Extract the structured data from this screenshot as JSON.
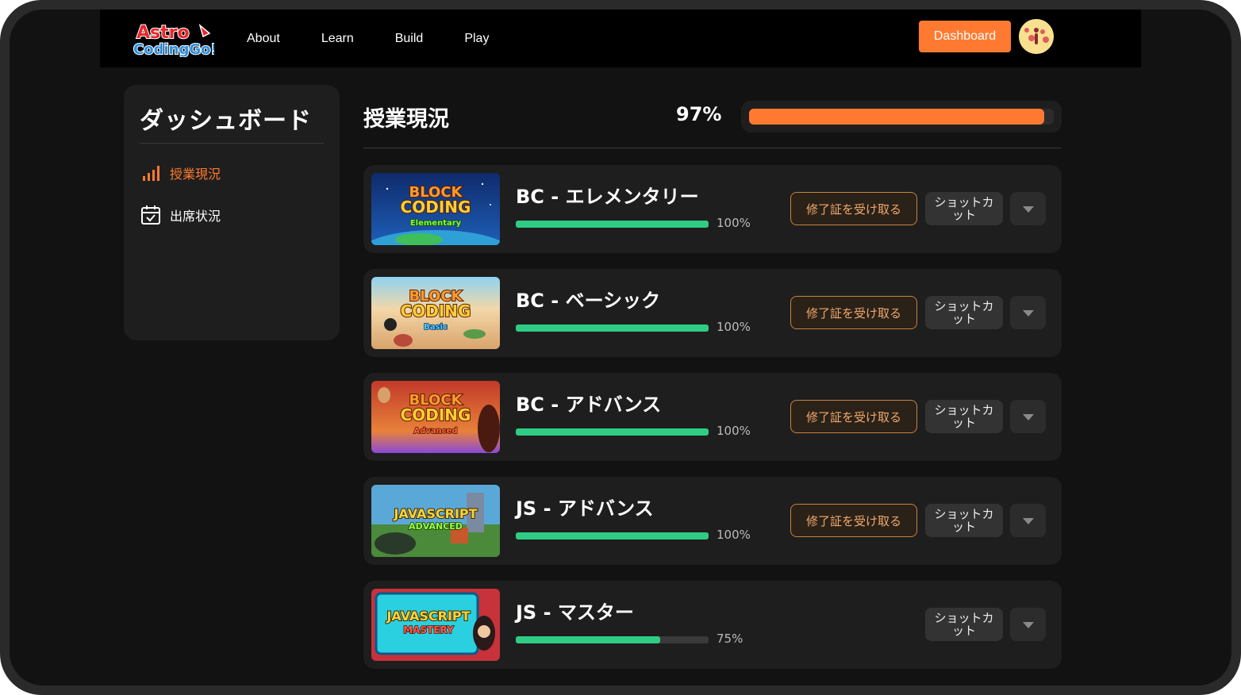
{
  "nav": {
    "logo_text": "Astro Coding Go!",
    "links": [
      "About",
      "Learn",
      "Build",
      "Play"
    ],
    "dashboard_label": "Dashboard"
  },
  "sidebar": {
    "title": "ダッシュボード",
    "items": [
      {
        "label": "授業現況",
        "icon": "bar-chart-icon",
        "active": true
      },
      {
        "label": "出席状況",
        "icon": "calendar-check-icon",
        "active": false
      }
    ]
  },
  "main": {
    "title": "授業現況",
    "overall_percent_label": "97%",
    "overall_percent": 97
  },
  "courses": [
    {
      "name": "BC - エレメンタリー",
      "percent": 100,
      "percent_label": "100%",
      "thumb_line1": "BLOCK",
      "thumb_line2": "CODING",
      "thumb_line3": "Elementary",
      "has_certificate": true
    },
    {
      "name": "BC - ベーシック",
      "percent": 100,
      "percent_label": "100%",
      "thumb_line1": "BLOCK",
      "thumb_line2": "CODING",
      "thumb_line3": "Basic",
      "has_certificate": true
    },
    {
      "name": "BC - アドバンス",
      "percent": 100,
      "percent_label": "100%",
      "thumb_line1": "BLOCK",
      "thumb_line2": "CODING",
      "thumb_line3": "Advanced",
      "has_certificate": true
    },
    {
      "name": "JS - アドバンス",
      "percent": 100,
      "percent_label": "100%",
      "thumb_line1": "JAVASCRIPT",
      "thumb_line2": "ADVANCED",
      "thumb_line3": "",
      "has_certificate": true
    },
    {
      "name": "JS - マスター",
      "percent": 75,
      "percent_label": "75%",
      "thumb_line1": "JAVASCRIPT",
      "thumb_line2": "MASTERY",
      "thumb_line3": "",
      "has_certificate": false
    }
  ],
  "buttons": {
    "certificate_label": "修了証を受け取る",
    "shortcut_label": "ショットカット"
  },
  "colors": {
    "accent": "#ff7a30",
    "progress": "#2ecc85",
    "certificate_border": "#c8823e"
  }
}
